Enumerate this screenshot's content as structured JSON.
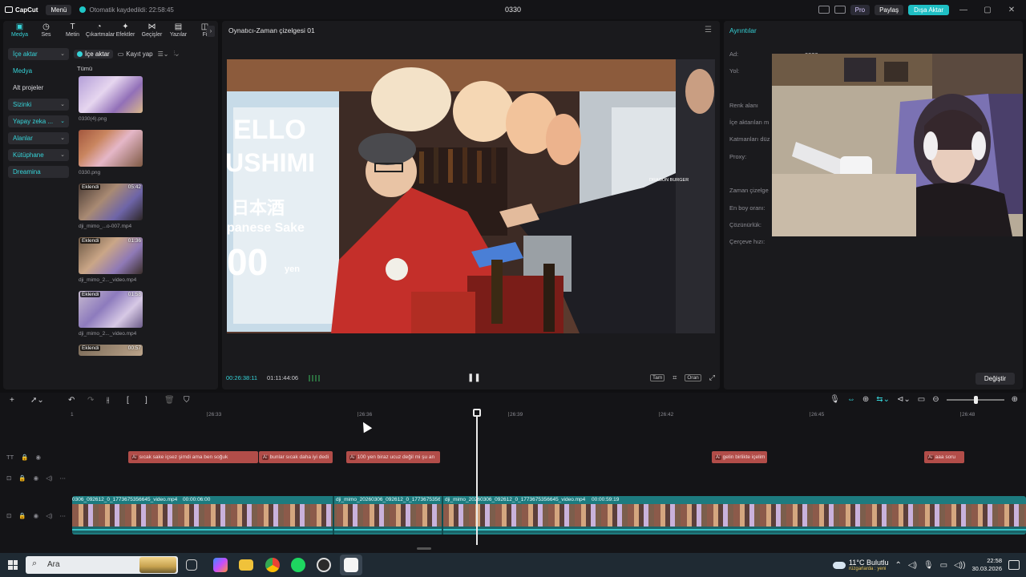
{
  "titlebar": {
    "app_name": "CapCut",
    "menu": "Menü",
    "autosave": "Otomatik kaydedildi: 22:58:45",
    "project": "0330",
    "pro": "Pro",
    "share": "Paylaş",
    "export": "Dışa Aktar",
    "win_min": "—",
    "win_max": "▢",
    "win_close": "✕"
  },
  "tabs": [
    {
      "label": "Medya",
      "icon": "▣"
    },
    {
      "label": "Ses",
      "icon": "◷"
    },
    {
      "label": "Metin",
      "icon": "T"
    },
    {
      "label": "Çıkartmalar",
      "icon": "◔"
    },
    {
      "label": "Efektler",
      "icon": "✦"
    },
    {
      "label": "Geçişler",
      "icon": "⋈"
    },
    {
      "label": "Yazılar",
      "icon": "▤"
    },
    {
      "label": "Fi",
      "icon": "◫"
    }
  ],
  "side_nav": [
    {
      "label": "İçe aktar",
      "chev": "⌄"
    },
    {
      "label": "Medya",
      "chev": ""
    },
    {
      "label": "Alt projeler",
      "chev": ""
    },
    {
      "label": "Sizinki",
      "chev": "⌄"
    },
    {
      "label": "Yapay zeka ...",
      "chev": "⌄"
    },
    {
      "label": "Alanlar",
      "chev": "⌄"
    },
    {
      "label": "Kütüphane",
      "chev": "⌄"
    },
    {
      "label": "Dreamina",
      "chev": ""
    }
  ],
  "media": {
    "import_label": "İçe aktar",
    "record_label": "Kayıt yap",
    "all_label": "Tümü",
    "items": [
      {
        "name": "0330(4).png",
        "added": "",
        "duration": ""
      },
      {
        "name": "0330.png",
        "added": "",
        "duration": ""
      },
      {
        "name": "dji_mimo_...o-007.mp4",
        "added": "Eklendi",
        "duration": "05:42"
      },
      {
        "name": "dji_mimo_2..._video.mp4",
        "added": "Eklendi",
        "duration": "01:36"
      },
      {
        "name": "dji_mimo_2..._video.mp4",
        "added": "Eklendi",
        "duration": "01:58"
      },
      {
        "name": "",
        "added": "Eklendi",
        "duration": "00:57"
      }
    ]
  },
  "player": {
    "title": "Oynatıcı-Zaman çizelgesi 01",
    "current_time": "00:26:38:11",
    "total_time": "01:11:44:06",
    "full_label": "Tam",
    "ratio_label": "Oran",
    "video_texts": {
      "sign_line1": "ELLO",
      "sign_line2": "USHIMI",
      "sign_jp": "日本酒",
      "sign_sake": "panese Sake",
      "sign_price": "00",
      "sign_yen": "yen",
      "shop_sign": "DRAGON BURGER"
    }
  },
  "details": {
    "title": "Ayrıntılar",
    "rows": [
      "Ad:",
      "Yol:",
      "",
      "Renk alanı",
      "İçe aktarılan m",
      "Katmanları düz",
      "Proxy:",
      "",
      "Zaman çizelge",
      "En boy oranı:",
      "Çözünürlük:",
      "Çerçeve hızı:"
    ],
    "name_value": "0330",
    "change_button": "Değiştir"
  },
  "timeline": {
    "ruler_ticks": [
      "26:33",
      "26:36",
      "26:39",
      "26:42",
      "26:45",
      "26:48"
    ],
    "ruler_start": "1",
    "text_clips": [
      "sıcak sake içsez şimdi ama ben soğuk",
      "bunlar sıcak daha iyi dedi",
      "100 yen biraz ucuz değil mi şu an",
      "gelin birlikte içelim",
      "aaa soru"
    ],
    "video_clips": [
      {
        "name": "0306_092612_0_1773675356645_video.mp4",
        "duration": "00:00:06:00"
      },
      {
        "name": "dji_mimo_20260306_092612_0_1773675356",
        "duration": ""
      },
      {
        "name": "dji_mimo_20260306_092612_0_1773675356645_video.mp4",
        "duration": "00:00:59:19"
      }
    ]
  },
  "taskbar": {
    "search_placeholder": "Ara",
    "weather_temp": "11°C",
    "weather_desc": "Bulutlu",
    "weather_sub": "rüzgarlarda : yeni",
    "time": "22:58",
    "date": "30.03.2026"
  },
  "colors": {
    "accent": "#36d3d8",
    "text_clip": "#b24d49",
    "video_track": "#1d7b7f"
  }
}
